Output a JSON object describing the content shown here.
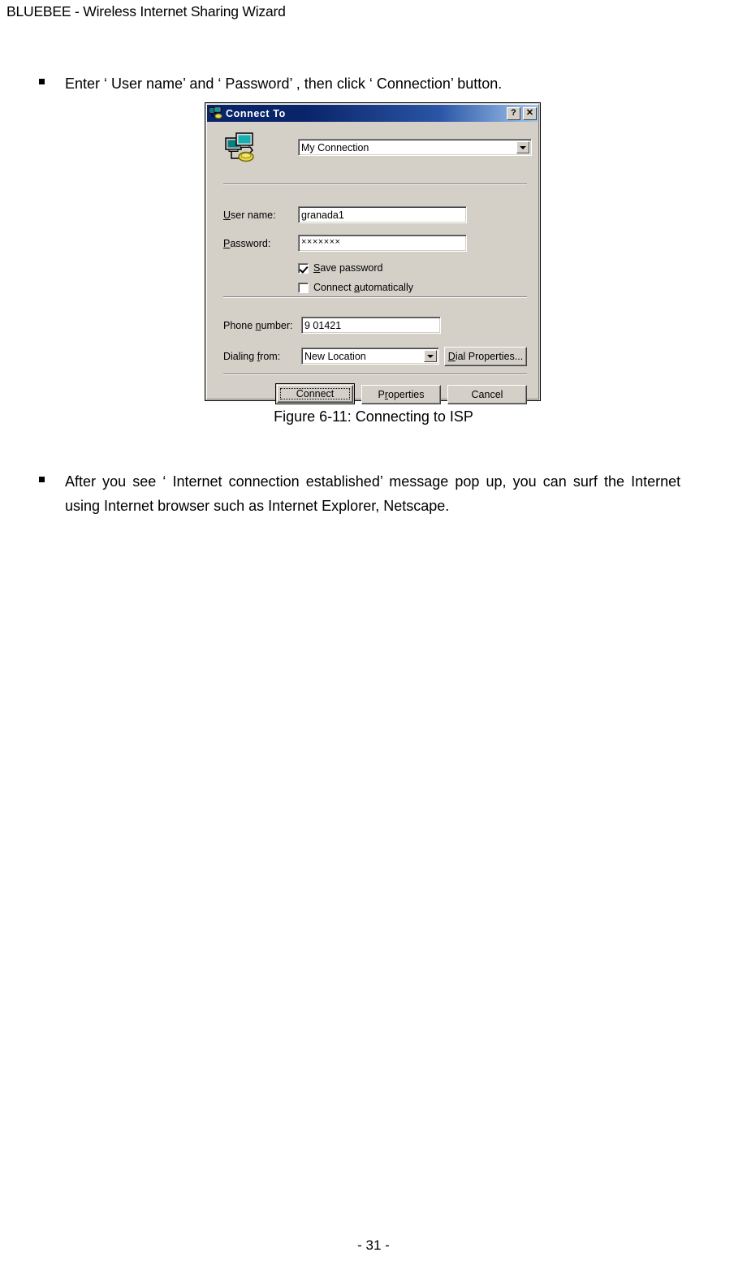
{
  "document": {
    "header": "BLUEBEE - Wireless Internet Sharing Wizard",
    "footer": "- 31 -",
    "figure_caption": "Figure 6-11: Connecting to ISP"
  },
  "bullets": [
    {
      "text": "Enter ‘ User name’  and ‘ Password’ , then click ‘ Connection’  button."
    },
    {
      "line1": "After you see ‘ Internet connection established’  message pop up, you can surf the Internet",
      "line2": "using Internet browser such as Internet Explorer, Netscape."
    }
  ],
  "dialog": {
    "title": "Connect To",
    "titlebar_icon": "connect-to-icon",
    "help_button": "?",
    "close_button": "✕",
    "connection_icon": "computers-modem-icon",
    "connection_combo": {
      "value": "My Connection",
      "options": [
        "My Connection"
      ]
    },
    "fields": {
      "user_name": {
        "label_pre": "U",
        "label_post": "ser name:",
        "value": "granada1"
      },
      "password": {
        "label_pre": "P",
        "label_post": "assword:",
        "value": "×××××××"
      },
      "phone_number": {
        "label_pre": "Phone ",
        "label_accel": "n",
        "label_post": "umber:",
        "value": "9 01421"
      },
      "dialing_from": {
        "label_pre": "Dialing ",
        "label_accel": "f",
        "label_post": "rom:",
        "value": "New Location",
        "options": [
          "New Location"
        ]
      }
    },
    "checkboxes": [
      {
        "name": "save-password",
        "label_pre": "S",
        "label_post": "ave password",
        "checked": true
      },
      {
        "name": "connect-automatically",
        "label_pre": "Connect ",
        "label_accel": "a",
        "label_post": "utomatically",
        "checked": false
      }
    ],
    "buttons": {
      "dial_properties": {
        "label_pre": "D",
        "label_post": "ial Properties..."
      },
      "connect": "Connect",
      "properties_pre": "P",
      "properties_accel": "r",
      "properties_post": "operties",
      "cancel": "Cancel"
    }
  },
  "colors": {
    "dialog_face": "#d4d0c8",
    "titlebar_start": "#0a246a",
    "titlebar_end": "#a6caf0",
    "field_bg": "#ffffff",
    "text": "#000000",
    "icon_screen": "#008080",
    "icon_modem": "#e8d84a"
  }
}
